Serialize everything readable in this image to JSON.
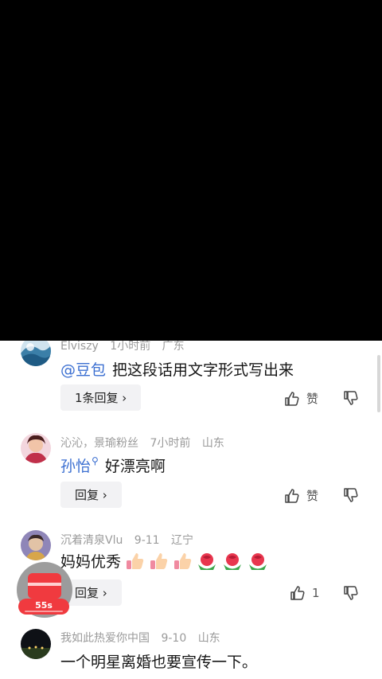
{
  "comments": [
    {
      "username": "Elviszy",
      "time": "1小时前",
      "location": "广东",
      "mention": "@豆包",
      "text": "把这段话用文字形式写出来",
      "reply_label": "1条回复 ›",
      "like_label": "赞"
    },
    {
      "username": "沁沁，景瑜粉丝",
      "time": "7小时前",
      "location": "山东",
      "mention": "孙怡",
      "text": "好漂亮啊",
      "reply_label": "回复 ›",
      "like_label": "赞"
    },
    {
      "username": "沉着清泉Vlu",
      "time": "9-11",
      "location": "辽宁",
      "text": "妈妈优秀",
      "emojis": [
        "thumbs-up-icon",
        "thumbs-up-icon",
        "thumbs-up-icon",
        "rose-icon",
        "rose-icon",
        "rose-icon"
      ],
      "reply_label": "回复 ›",
      "like_label": "1"
    },
    {
      "username": "我如此热爱你中国",
      "time": "9-10",
      "location": "山东",
      "text": "一个明星离婚也要宣传一下。"
    }
  ],
  "floating_widget": {
    "icon": "red-packet-icon",
    "timer": "55s"
  },
  "colors": {
    "mention": "#3b6fd1",
    "accent_red": "#f03a3f"
  }
}
